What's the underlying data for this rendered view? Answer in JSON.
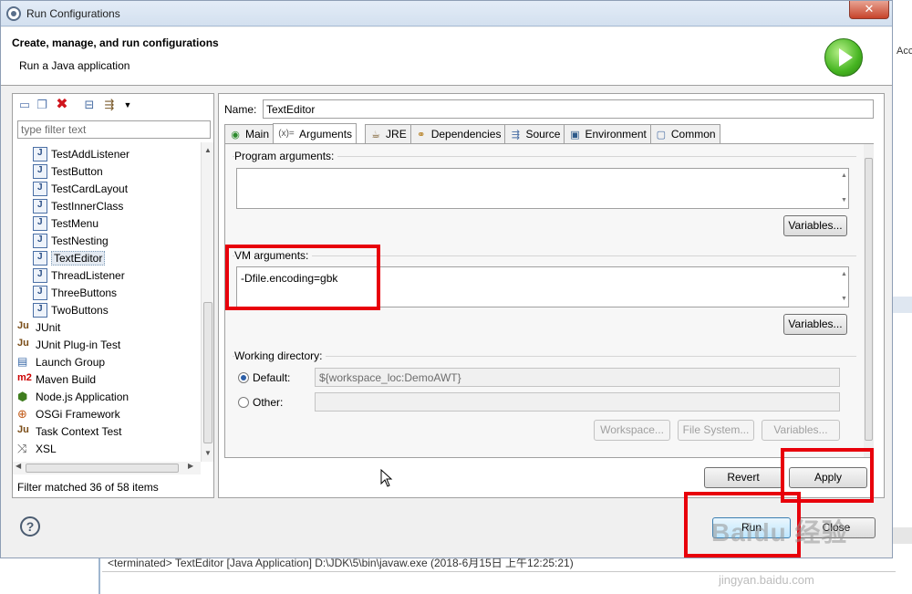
{
  "background": {
    "right_label": "Acc",
    "console_text": "<terminated> TextEditor [Java Application] D:\\JDK\\5\\bin\\javaw.exe (2018-6月15日 上午12:25:21)"
  },
  "window": {
    "title": "Run Configurations",
    "close_glyph": "✕"
  },
  "banner": {
    "heading": "Create, manage, and run configurations",
    "subtitle": "Run a Java application"
  },
  "left": {
    "filter_placeholder": "type filter text",
    "items": [
      {
        "label": "TestAddListener",
        "icon": "java-app-icon"
      },
      {
        "label": "TestButton",
        "icon": "java-app-icon"
      },
      {
        "label": "TestCardLayout",
        "icon": "java-app-icon"
      },
      {
        "label": "TestInnerClass",
        "icon": "java-app-icon"
      },
      {
        "label": "TestMenu",
        "icon": "java-app-icon"
      },
      {
        "label": "TestNesting",
        "icon": "java-app-icon"
      },
      {
        "label": "TextEditor",
        "icon": "java-app-icon"
      },
      {
        "label": "ThreadListener",
        "icon": "java-app-icon"
      },
      {
        "label": "ThreeButtons",
        "icon": "java-app-icon"
      },
      {
        "label": "TwoButtons",
        "icon": "java-app-icon"
      },
      {
        "label": "JUnit",
        "icon": "junit-icon"
      },
      {
        "label": "JUnit Plug-in Test",
        "icon": "junit-plugin-icon"
      },
      {
        "label": "Launch Group",
        "icon": "launch-group-icon"
      },
      {
        "label": "Maven Build",
        "icon": "maven-icon"
      },
      {
        "label": "Node.js Application",
        "icon": "nodejs-icon"
      },
      {
        "label": "OSGi Framework",
        "icon": "osgi-icon"
      },
      {
        "label": "Task Context Test",
        "icon": "task-context-icon"
      },
      {
        "label": "XSL",
        "icon": "xsl-icon"
      }
    ],
    "status": "Filter matched 36 of 58 items"
  },
  "config": {
    "name_label": "Name:",
    "name_value": "TextEditor",
    "tabs": [
      {
        "label": "Main",
        "icon": "main-tab-icon",
        "glyph": "◉"
      },
      {
        "label": "Arguments",
        "icon": "arguments-tab-icon",
        "glyph": "(x)="
      },
      {
        "label": "JRE",
        "icon": "jre-tab-icon",
        "glyph": "☕"
      },
      {
        "label": "Dependencies",
        "icon": "dependencies-tab-icon",
        "glyph": "⚭"
      },
      {
        "label": "Source",
        "icon": "source-tab-icon",
        "glyph": "⇶"
      },
      {
        "label": "Environment",
        "icon": "environment-tab-icon",
        "glyph": "▣"
      },
      {
        "label": "Common",
        "icon": "common-tab-icon",
        "glyph": "▢"
      }
    ],
    "program_args_label": "Program arguments:",
    "program_args_value": "",
    "vm_args_label": "VM arguments:",
    "vm_args_value": "-Dfile.encoding=gbk",
    "variables_label": "Variables...",
    "workdir_label": "Working directory:",
    "default_label": "Default:",
    "default_value": "${workspace_loc:DemoAWT}",
    "other_label": "Other:",
    "workspace_btn": "Workspace...",
    "filesystem_btn": "File System...",
    "variables_btn": "Variables..."
  },
  "actions": {
    "revert": "Revert",
    "apply": "Apply",
    "run": "Run",
    "close": "Close"
  },
  "watermark": {
    "main": "Baidu 经验",
    "sub": "jingyan.baidu.com"
  }
}
